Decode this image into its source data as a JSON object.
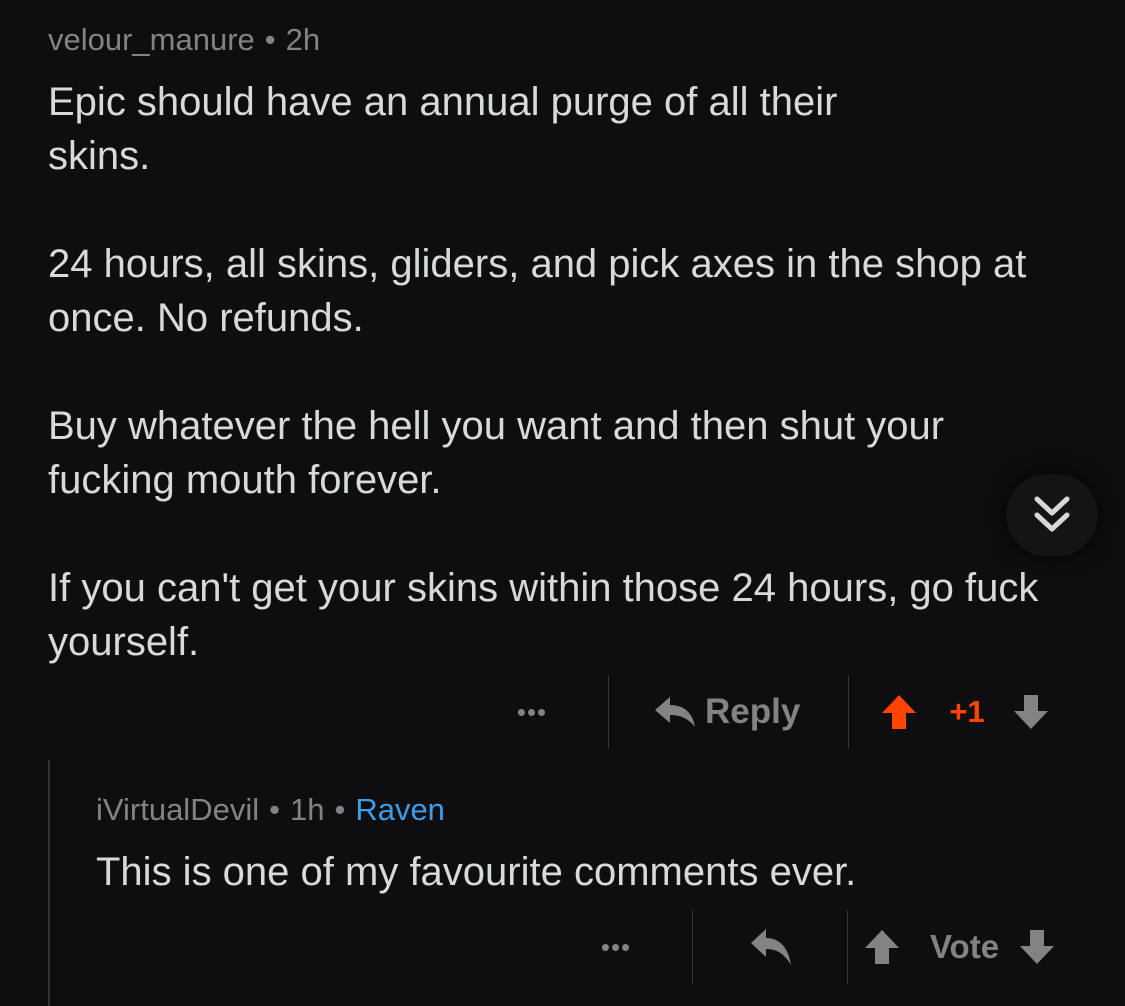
{
  "comment": {
    "author": "velour_manure",
    "separator": "•",
    "age": "2h",
    "paragraphs": [
      "Epic should have an annual purge of all their skins.",
      "24 hours, all skins, gliders, and pick axes in the shop at once. No refunds.",
      "Buy whatever the hell you want and then shut your fucking mouth forever.",
      "If you can't get your skins within those 24 hours, go fuck yourself."
    ],
    "actions": {
      "more": "•••",
      "reply_label": "Reply",
      "score": "+1"
    },
    "collapse_icon": "double-chevron-down-icon"
  },
  "reply": {
    "author": "iVirtualDevil",
    "separator": "•",
    "age": "1h",
    "flair": "Raven",
    "text": "This is one of my favourite comments ever.",
    "actions": {
      "more": "•••",
      "vote_label": "Vote"
    }
  },
  "colors": {
    "background": "#0e0e10",
    "text": "#d7dadc",
    "meta": "#818384",
    "upvote_active": "#ff4500",
    "flair": "#3d9be9"
  }
}
